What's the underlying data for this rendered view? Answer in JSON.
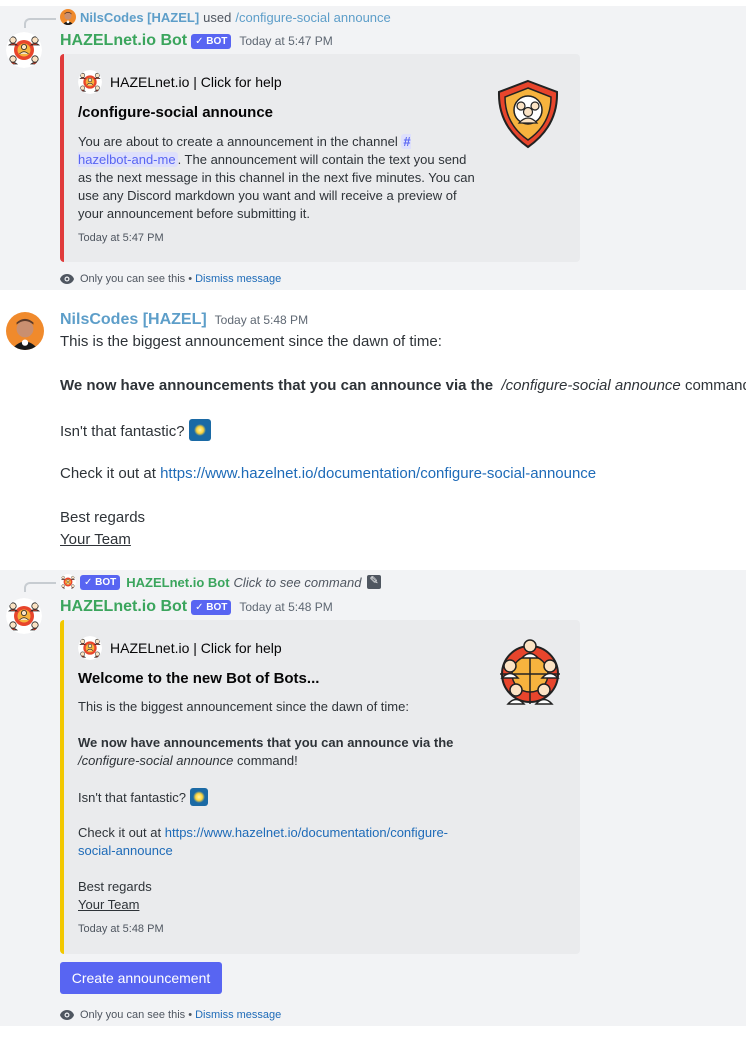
{
  "messages": {
    "first": {
      "reply": {
        "user": "NilsCodes [HAZEL]",
        "used": "used",
        "command": "/configure-social announce"
      },
      "author": "HAZELnet.io Bot",
      "bot_tag": "BOT",
      "timestamp": "Today at 5:47 PM",
      "embed": {
        "author": "HAZELnet.io | Click for help",
        "title": "/configure-social announce",
        "desc_before": "You are about to create a announcement in the channel",
        "channel_hash": "#",
        "channel_name": "hazelbot-and-me",
        "desc_after": ". The announcement will contain the text you send as the next message in this channel in the next five minutes. You can use any Discord markdown you want and will receive a preview of your announcement before submitting it.",
        "footer": "Today at 5:47 PM",
        "color": "#e03b3b"
      },
      "only_you": "Only you can see this",
      "dismiss_separator": "•",
      "dismiss": "Dismiss message"
    },
    "second": {
      "author": "NilsCodes [HAZEL]",
      "timestamp": "Today at 5:48 PM",
      "line1": "This is the biggest announcement since the dawn of time:",
      "line2_bold": "We now have announcements that you can announce via the",
      "line2_cmd": "/configure-social announce",
      "line2_end": "command!",
      "line3": "Isn't that fantastic?",
      "line4_prefix": "Check it out at",
      "line4_link": "https://www.hazelnet.io/documentation/configure-social-announce",
      "line5": "Best regards",
      "line6": "Your Team"
    },
    "third": {
      "reply": {
        "bot_tag": "BOT",
        "bot_name": "HAZELnet.io Bot",
        "click": "Click to see command"
      },
      "author": "HAZELnet.io Bot",
      "bot_tag": "BOT",
      "timestamp": "Today at 5:48 PM",
      "embed": {
        "author": "HAZELnet.io | Click for help",
        "title": "Welcome to the new Bot of Bots...",
        "line1": "This is the biggest announcement since the dawn of time:",
        "line2_bold": "We now have announcements that you can announce via the",
        "line2_cmd": "/configure-social announce",
        "line2_end": "command!",
        "line3": "Isn't that fantastic?",
        "line4_prefix": "Check it out at",
        "line4_link_a": "https://www.hazelnet.io/documentation/configure-",
        "line4_link_b": "social-announce",
        "line5": "Best regards",
        "line6": "Your Team",
        "footer": "Today at 5:48 PM",
        "color": "#f2c800"
      },
      "button": "Create announcement",
      "only_you": "Only you can see this",
      "dismiss_separator": "•",
      "dismiss": "Dismiss message"
    }
  },
  "icons": {
    "bot_avatar": "hazel-bot-avatar-icon",
    "user_avatar": "user-avatar-icon",
    "eye": "eye-icon",
    "shield_thumb": "shield-people-icon",
    "group_thumb": "group-people-icon",
    "edit": "edit-icon",
    "sparkle": "sparkle-emoji-icon"
  },
  "colors": {
    "bot_name": "#3ba55d",
    "user_name": "#5d9ec9",
    "blurple": "#5865f2",
    "link": "#1e6bb8"
  }
}
